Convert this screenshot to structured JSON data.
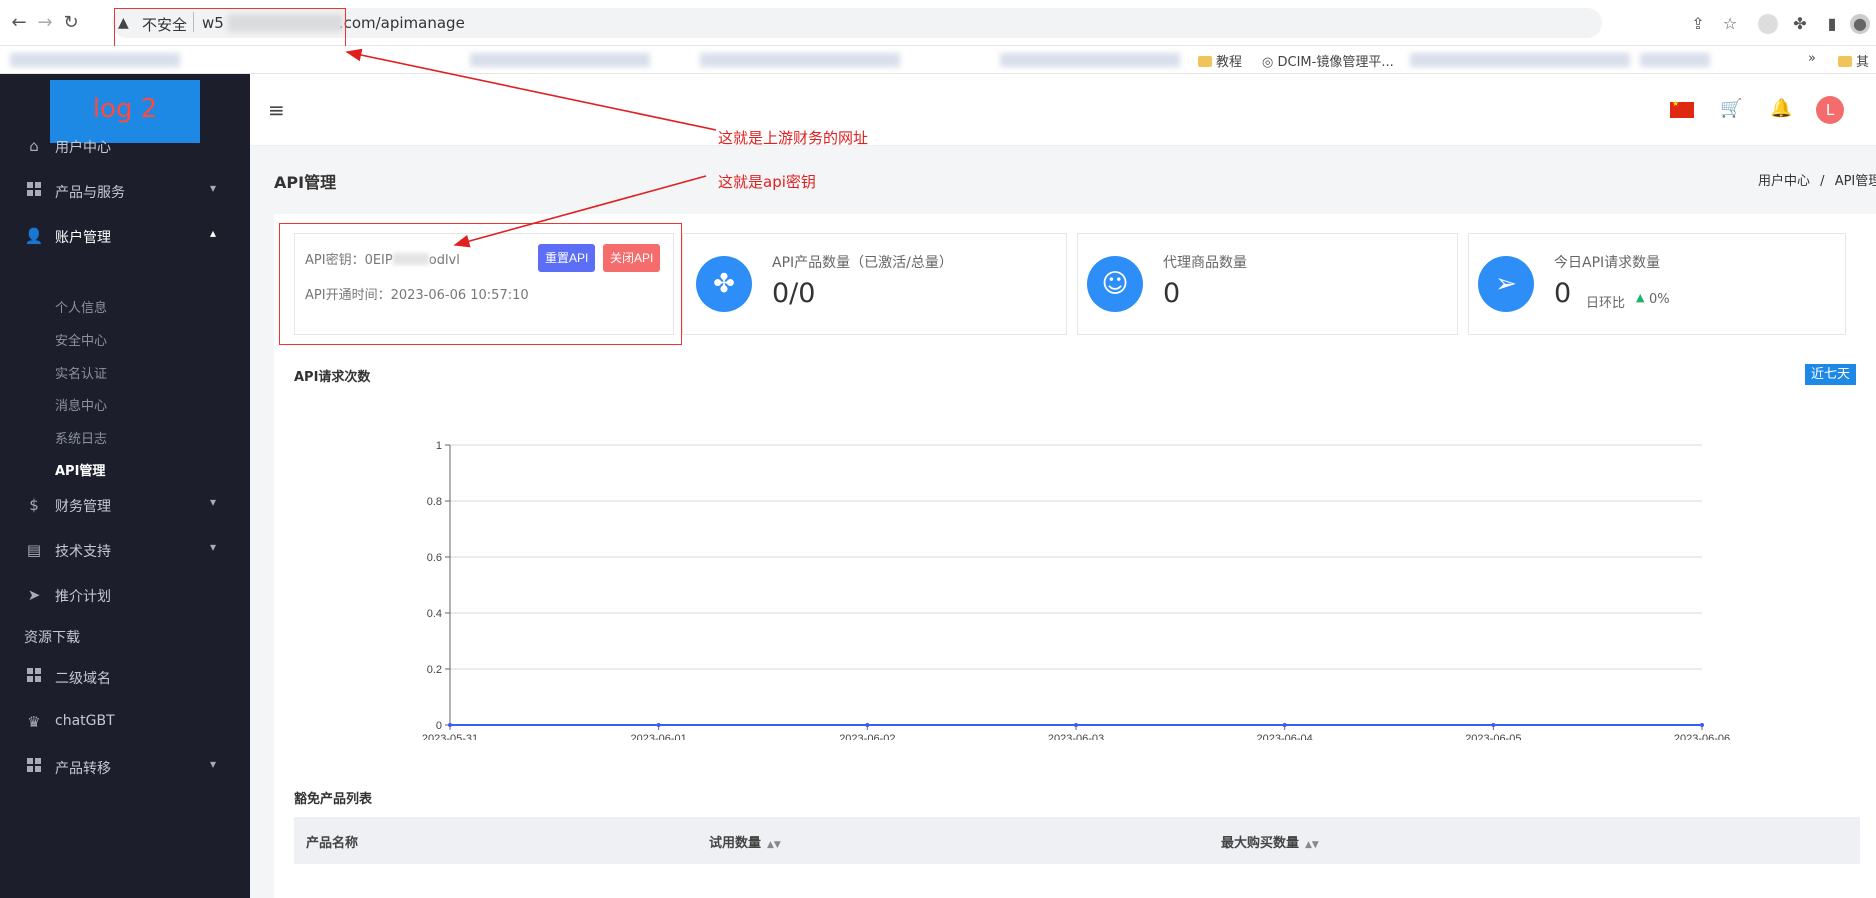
{
  "browser": {
    "url_warning": "不安全",
    "url_prefix": "w5",
    "url_suffix": ".com/apimanage",
    "bookmarks": [
      "教程",
      "DCIM-镜像管理平..."
    ],
    "bookmark_more": "»",
    "bookmark_folder": "其"
  },
  "sidebar": {
    "logo": "log 2",
    "menu": [
      {
        "label": "用户中心",
        "icon": "home-icon"
      },
      {
        "label": "产品与服务",
        "icon": "grid-icon"
      },
      {
        "label": "账户管理",
        "icon": "user-icon"
      },
      {
        "label": "财务管理",
        "icon": "dollar-icon"
      },
      {
        "label": "技术支持",
        "icon": "document-icon"
      },
      {
        "label": "推介计划",
        "icon": "send-icon"
      },
      {
        "label": "资源下载",
        "icon": ""
      },
      {
        "label": "二级域名",
        "icon": "grid-icon"
      },
      {
        "label": "chatGBT",
        "icon": "crown-icon"
      },
      {
        "label": "产品转移",
        "icon": "grid-icon"
      }
    ],
    "submenu": [
      "个人信息",
      "安全中心",
      "实名认证",
      "消息中心",
      "系统日志",
      "API管理"
    ]
  },
  "header": {
    "language": "zh-CN",
    "avatar_letter": "L"
  },
  "page": {
    "title": "API管理",
    "breadcrumb": [
      "用户中心",
      "/",
      "API管理"
    ]
  },
  "key_card": {
    "key_label": "API密钥：0EIP",
    "key_tail": "odlvl",
    "open_time": "API开通时间：2023-06-06 10:57:10",
    "reset_button": "重置API",
    "close_button": "关闭API"
  },
  "stats": [
    {
      "label": "API产品数量（已激活/总量）",
      "value": "0/0",
      "icon": "flower-icon"
    },
    {
      "label": "代理商品数量",
      "value": "0",
      "icon": "agent-icon"
    },
    {
      "label": "今日API请求数量",
      "value": "0",
      "icon": "paper-plane-icon",
      "compare_label": "日环比",
      "compare_value": "0%"
    }
  ],
  "annotations": {
    "url_note": "这就是上游财务的网址",
    "key_note": "这就是api密钥",
    "color": "#e02020"
  },
  "chart": {
    "title": "API请求次数",
    "range_button": "近七天"
  },
  "chart_data": {
    "type": "line",
    "x": [
      "2023-05-31",
      "2023-06-01",
      "2023-06-02",
      "2023-06-03",
      "2023-06-04",
      "2023-06-05",
      "2023-06-06"
    ],
    "series": [
      {
        "values": [
          0,
          0,
          0,
          0,
          0,
          0,
          0
        ],
        "color": "#3a5cf5"
      }
    ],
    "ylim": [
      0,
      1
    ],
    "yticks": [
      "0",
      "0.2",
      "0.4",
      "0.6",
      "0.8",
      "1"
    ],
    "grid": true
  },
  "table": {
    "title": "豁免产品列表",
    "columns": [
      "产品名称",
      "试用数量",
      "最大购买数量"
    ]
  }
}
